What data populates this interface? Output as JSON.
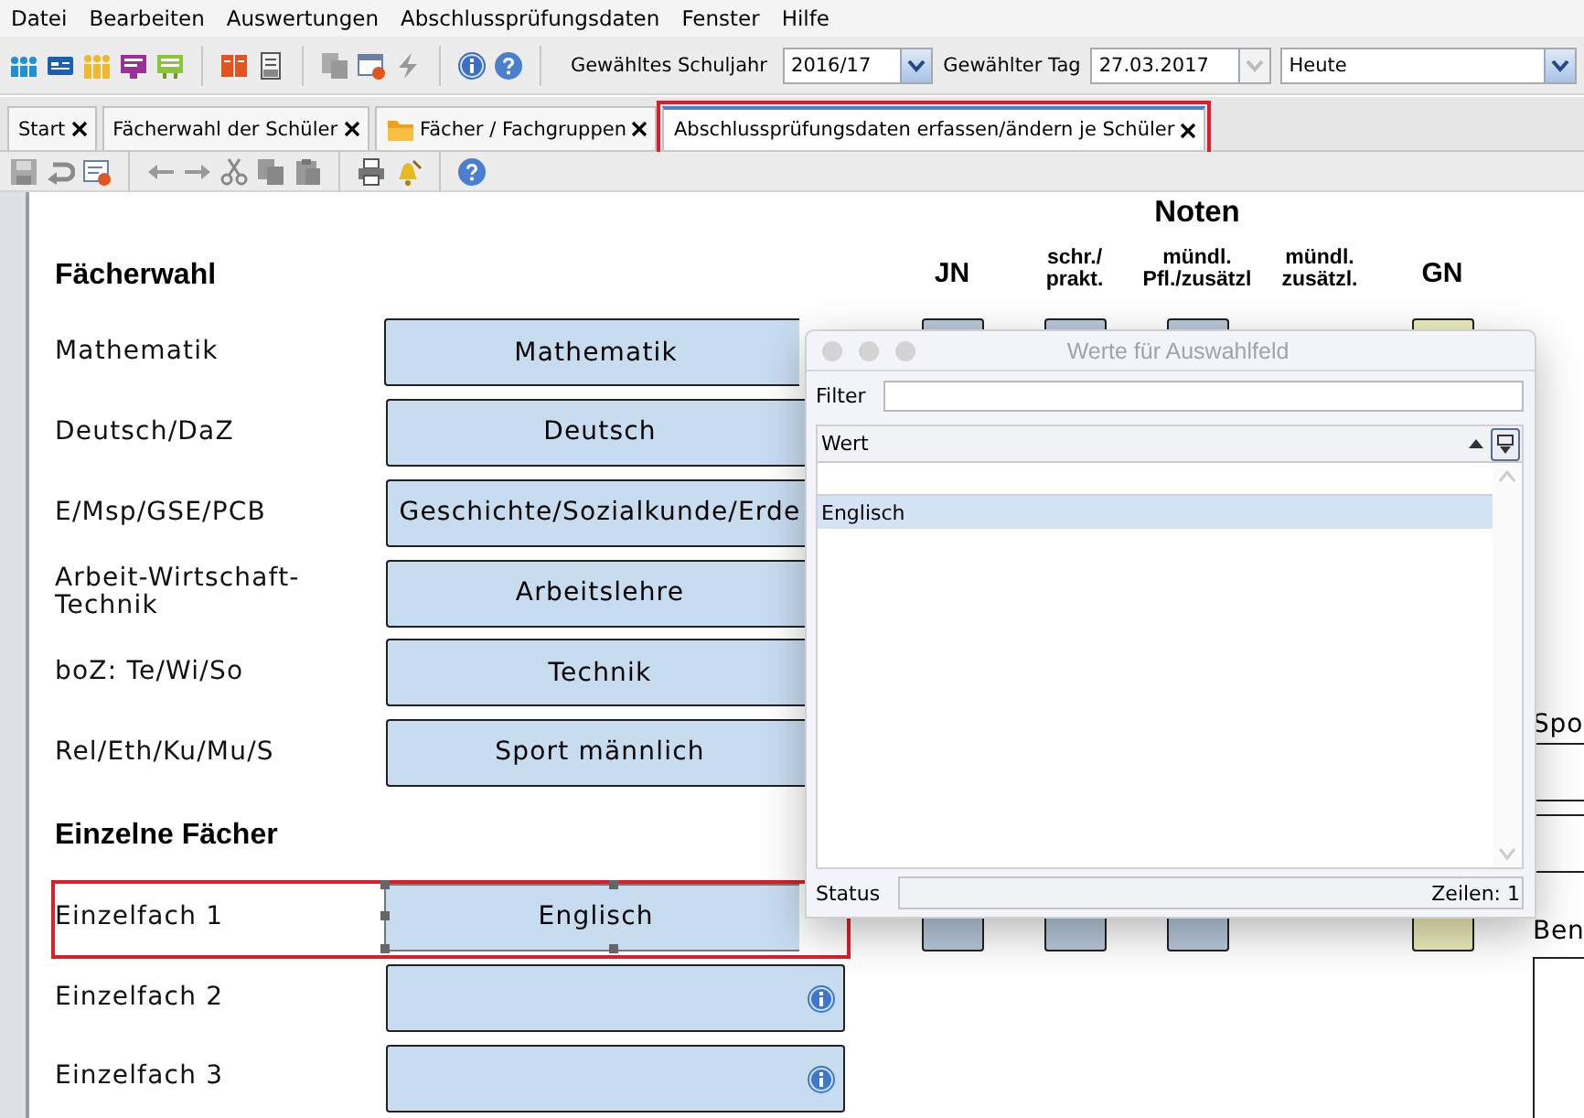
{
  "menu": [
    "Datei",
    "Bearbeiten",
    "Auswertungen",
    "Abschlussprüfungsdaten",
    "Fenster",
    "Hilfe"
  ],
  "toolbar": {
    "school_year_label": "Gewähltes Schuljahr",
    "school_year": "2016/17",
    "day_label": "Gewählter Tag",
    "day": "27.03.2017",
    "day_preset": "Heute"
  },
  "tabs": [
    {
      "label": "Start",
      "kind": "plain",
      "selected": false
    },
    {
      "label": "Fächerwahl der Schüler",
      "kind": "plain",
      "selected": false
    },
    {
      "label": "Fächer / Fachgruppen",
      "kind": "folder",
      "selected": false
    },
    {
      "label": "Abschlussprüfungsdaten erfassen/ändern je Schüler",
      "kind": "plain",
      "selected": true
    }
  ],
  "grades": {
    "title": "Noten",
    "columns": [
      {
        "label": "JN",
        "kind": "input"
      },
      {
        "label": "schr./\nprakt.",
        "kind": "input"
      },
      {
        "label": "mündl.\nPfl./zusätzl",
        "kind": "input"
      },
      {
        "label": "mündl.\nzusätzl.",
        "kind": "none"
      },
      {
        "label": "GN",
        "kind": "final"
      }
    ]
  },
  "sections": [
    {
      "heading": "Fächerwahl",
      "rows": [
        {
          "label": "Mathematik",
          "value": "Mathematik",
          "graded": true,
          "selected": false
        },
        {
          "label": "Deutsch/DaZ",
          "value": "Deutsch",
          "selected": false
        },
        {
          "label": "E/Msp/GSE/PCB",
          "value": "Geschichte/Sozialkunde/Erde",
          "selected": false
        },
        {
          "label": "Arbeit-Wirtschaft-Technik",
          "value": "Arbeitslehre",
          "selected": false
        },
        {
          "label": "boZ: Te/Wi/So",
          "value": "Technik",
          "selected": false
        },
        {
          "label": "Rel/Eth/Ku/Mu/S",
          "value": "Sport männlich",
          "selected": false
        }
      ]
    },
    {
      "heading": "Einzelne Fächer",
      "rows": [
        {
          "label": "Einzelfach 1",
          "value": "Englisch",
          "graded": true,
          "selected": true
        },
        {
          "label": "Einzelfach 2",
          "graded": false,
          "selected": false
        },
        {
          "label": "Einzelfach 3",
          "graded": false,
          "selected": false
        }
      ]
    }
  ],
  "right_panel": {
    "label_1": "Spo",
    "label_2": "Ben"
  },
  "dialog": {
    "title": "Werte für Auswahlfeld",
    "filter_label": "Filter",
    "column": "Wert",
    "rows": [
      {
        "value": "Englisch",
        "selected": true
      }
    ],
    "status_label": "Status",
    "status": "Zeilen: 1"
  }
}
